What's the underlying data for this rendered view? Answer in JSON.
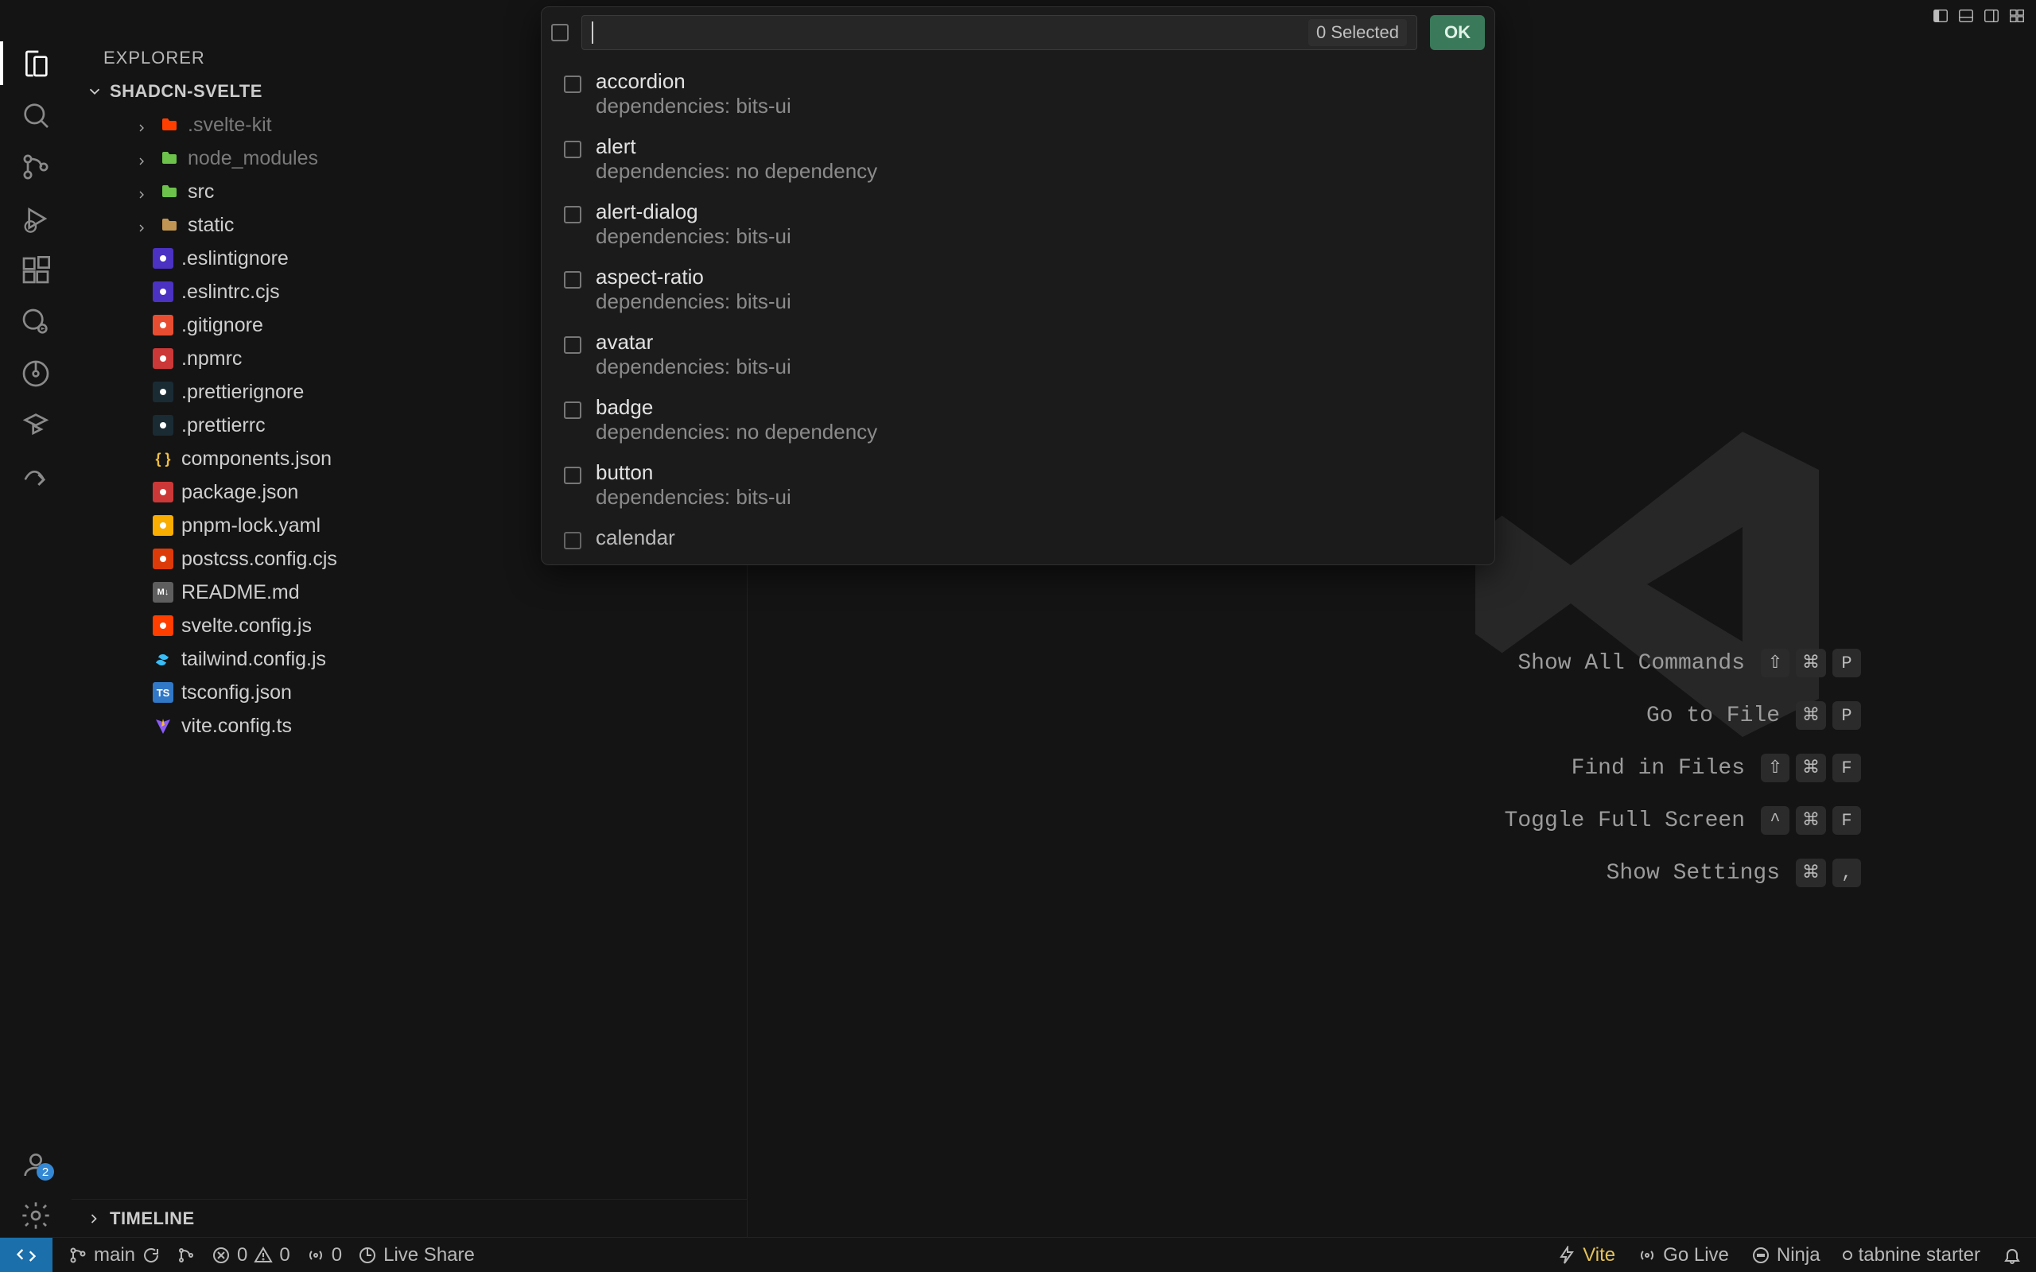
{
  "titlebar": {
    "layout_buttons": [
      "primary-side-bar",
      "panel",
      "secondary-side-bar",
      "layout"
    ]
  },
  "activity": {
    "account_badge": "2"
  },
  "sidebar": {
    "title": "EXPLORER",
    "project": "SHADCN-SVELTE",
    "timeline": "TIMELINE",
    "tree": [
      {
        "type": "dir",
        "name": ".svelte-kit",
        "dim": true,
        "icon": "svelte"
      },
      {
        "type": "dir",
        "name": "node_modules",
        "dim": true,
        "icon": "node"
      },
      {
        "type": "dir",
        "name": "src",
        "icon": "svelte-src"
      },
      {
        "type": "dir",
        "name": "static",
        "icon": "folder"
      },
      {
        "type": "file",
        "name": ".eslintignore",
        "icon": "eslint"
      },
      {
        "type": "file",
        "name": ".eslintrc.cjs",
        "icon": "eslint"
      },
      {
        "type": "file",
        "name": ".gitignore",
        "icon": "git"
      },
      {
        "type": "file",
        "name": ".npmrc",
        "icon": "npm"
      },
      {
        "type": "file",
        "name": ".prettierignore",
        "icon": "prettier"
      },
      {
        "type": "file",
        "name": ".prettierrc",
        "icon": "prettier"
      },
      {
        "type": "file",
        "name": "components.json",
        "icon": "braces"
      },
      {
        "type": "file",
        "name": "package.json",
        "icon": "npm"
      },
      {
        "type": "file",
        "name": "pnpm-lock.yaml",
        "icon": "pnpm"
      },
      {
        "type": "file",
        "name": "postcss.config.cjs",
        "icon": "postcss"
      },
      {
        "type": "file",
        "name": "README.md",
        "icon": "md"
      },
      {
        "type": "file",
        "name": "svelte.config.js",
        "icon": "svelte"
      },
      {
        "type": "file",
        "name": "tailwind.config.js",
        "icon": "tailwind"
      },
      {
        "type": "file",
        "name": "tsconfig.json",
        "icon": "ts"
      },
      {
        "type": "file",
        "name": "vite.config.ts",
        "icon": "vite"
      }
    ]
  },
  "quickpick": {
    "selected_badge": "0 Selected",
    "ok": "OK",
    "items": [
      {
        "label": "accordion",
        "desc": "dependencies: bits-ui"
      },
      {
        "label": "alert",
        "desc": "dependencies: no dependency"
      },
      {
        "label": "alert-dialog",
        "desc": "dependencies: bits-ui"
      },
      {
        "label": "aspect-ratio",
        "desc": "dependencies: bits-ui"
      },
      {
        "label": "avatar",
        "desc": "dependencies: bits-ui"
      },
      {
        "label": "badge",
        "desc": "dependencies: no dependency"
      },
      {
        "label": "button",
        "desc": "dependencies: bits-ui"
      },
      {
        "label": "calendar",
        "desc": "",
        "cut": true
      }
    ]
  },
  "welcome": {
    "rows": [
      {
        "label": "Show All Commands",
        "keys": [
          "⇧",
          "⌘",
          "P"
        ]
      },
      {
        "label": "Go to File",
        "keys": [
          "⌘",
          "P"
        ]
      },
      {
        "label": "Find in Files",
        "keys": [
          "⇧",
          "⌘",
          "F"
        ]
      },
      {
        "label": "Toggle Full Screen",
        "keys": [
          "^",
          "⌘",
          "F"
        ]
      },
      {
        "label": "Show Settings",
        "keys": [
          "⌘",
          ","
        ]
      }
    ]
  },
  "status": {
    "branch": "main",
    "errors": "0",
    "warnings": "0",
    "ports": "0",
    "live_share": "Live Share",
    "vite": "Vite",
    "go_live": "Go Live",
    "ninja": "Ninja",
    "tabnine": "tabnine starter"
  },
  "icon_colors": {
    "svelte": "#ff3e00",
    "node": "#6cc24a",
    "folder": "#c09553",
    "eslint": "#4b32c3",
    "git": "#e84d31",
    "npm": "#cb3837",
    "prettier": "#1a2b34",
    "braces": "#f0c040",
    "pnpm": "#f9ad00",
    "postcss": "#dd3a0a",
    "md": "#5e5e5e",
    "tailwind": "#38bdf8",
    "ts": "#3178c6",
    "vite": "#8b5cf6",
    "svelte-src": "#6cc24a"
  }
}
